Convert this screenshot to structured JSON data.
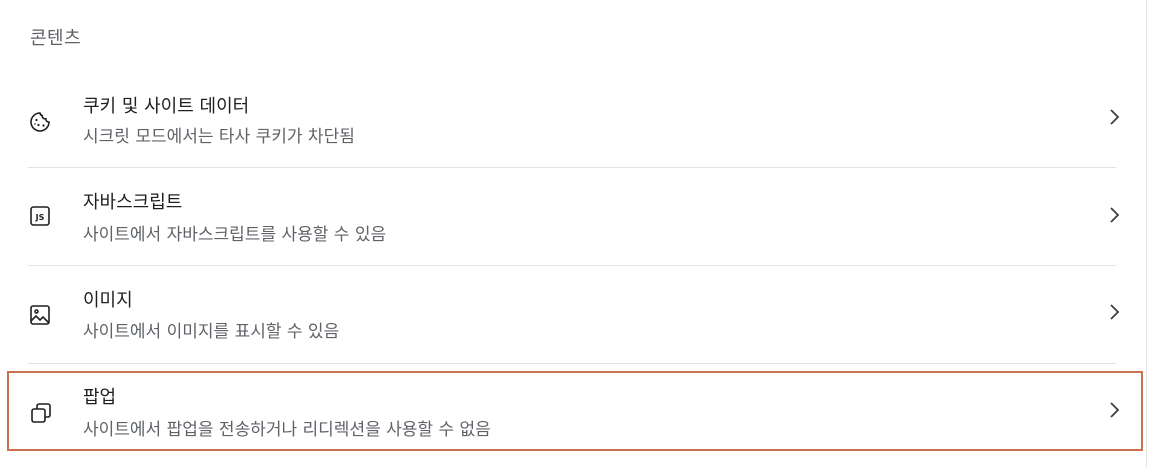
{
  "section": {
    "title": "콘텐츠"
  },
  "items": [
    {
      "icon": "cookie-icon",
      "title": "쿠키 및 사이트 데이터",
      "subtitle": "시크릿 모드에서는 타사 쿠키가 차단됨"
    },
    {
      "icon": "javascript-icon",
      "title": "자바스크립트",
      "subtitle": "사이트에서 자바스크립트를 사용할 수 있음"
    },
    {
      "icon": "image-icon",
      "title": "이미지",
      "subtitle": "사이트에서 이미지를 표시할 수 있음"
    },
    {
      "icon": "popup-icon",
      "title": "팝업",
      "subtitle": "사이트에서 팝업을 전송하거나 리디렉션을 사용할 수 없음"
    }
  ],
  "colors": {
    "highlight_border": "#c8714e",
    "title_text": "#1f1f1f",
    "subtitle_text": "#5f6368",
    "divider": "#e3e3e3"
  }
}
